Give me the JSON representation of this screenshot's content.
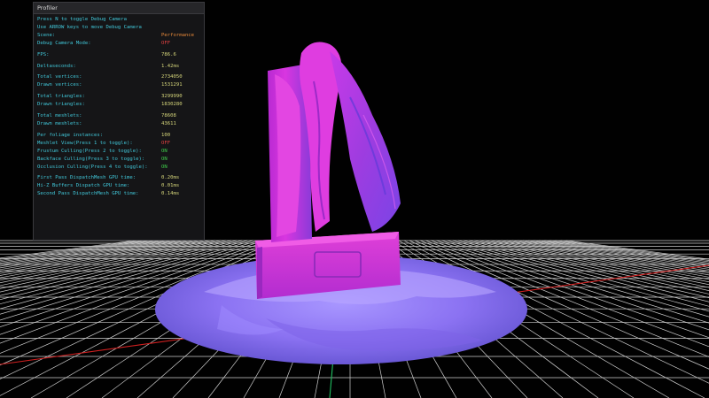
{
  "profiler": {
    "title": "Profiler",
    "hints": [
      "Press N to toggle Debug Camera",
      "Use ARROW keys to move Debug Camera"
    ],
    "scene": {
      "label": "Scene:",
      "value": "Performance"
    },
    "debug_camera_mode": {
      "label": "Debug Camera Mode:",
      "value": "OFF"
    },
    "fps": {
      "label": "FPS:",
      "value": "786.6"
    },
    "deltaseconds": {
      "label": "Deltaseconds:",
      "value": "1.42ms"
    },
    "total_vertices": {
      "label": "Total vertices:",
      "value": "2734050"
    },
    "drawn_vertices": {
      "label": "Drawn vertices:",
      "value": "1531291"
    },
    "total_triangles": {
      "label": "Total triangles:",
      "value": "3299990"
    },
    "drawn_triangles": {
      "label": "Drawn triangles:",
      "value": "1830280"
    },
    "total_meshlets": {
      "label": "Total meshlets:",
      "value": "78608"
    },
    "drawn_meshlets": {
      "label": "Drawn meshlets:",
      "value": "43611"
    },
    "foliage_instances": {
      "label": "Per foliage instances:",
      "value": "100"
    },
    "meshlet_view": {
      "label": "Meshlet View(Press 1 to toggle):",
      "value": "OFF"
    },
    "frustum_culling": {
      "label": "Frustum Culling(Press 2 to toggle):",
      "value": "ON"
    },
    "backface_culling": {
      "label": "Backface Culling(Press 3 to toggle):",
      "value": "ON"
    },
    "occlusion_culling": {
      "label": "Occlusion Culling(Press 4 to toggle):",
      "value": "ON"
    },
    "first_pass_gpu": {
      "label": "First Pass DispatchMesh GPU time:",
      "value": "0.20ms"
    },
    "hiz_gpu": {
      "label": "Hi-Z Buffers Dispatch GPU time:",
      "value": "0.01ms"
    },
    "second_pass_gpu": {
      "label": "Second Pass DispatchMesh GPU time:",
      "value": "0.14ms"
    }
  },
  "colors": {
    "background": "#010101",
    "grid": "#d0d0d0",
    "axis_x": "#d02020",
    "axis_z": "#20c060",
    "statue": "#d32fd8",
    "ground": "#8a6ff0",
    "label_text": "#41c7d9",
    "value_text": "#d4d47a",
    "value_on": "#3fd04a",
    "value_off": "#e04040"
  }
}
